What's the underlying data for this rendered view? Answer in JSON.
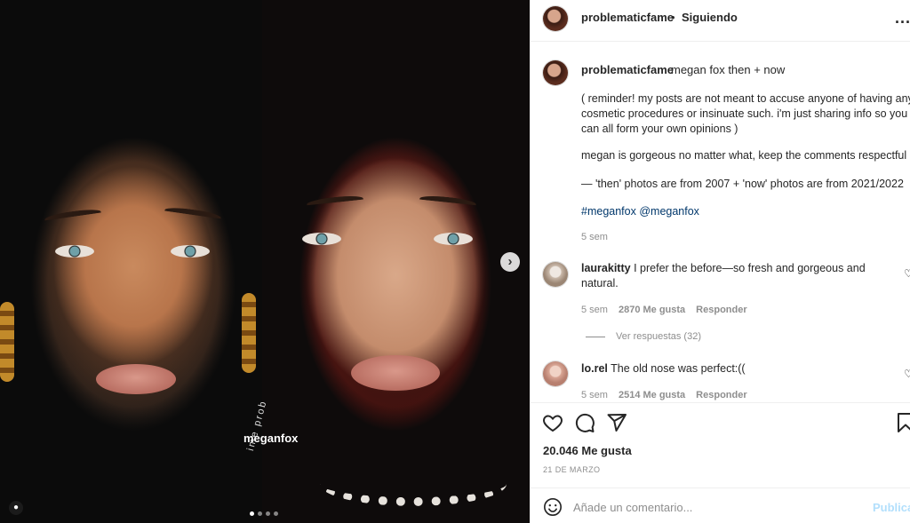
{
  "media": {
    "watermark_name": "meganfox",
    "watermark_sub": "ime prob",
    "next_glyph": "›",
    "carousel": {
      "count": 4,
      "active_index": 0
    }
  },
  "header": {
    "username": "problematicfame",
    "separator": "•",
    "follow_status": "Siguiendo",
    "more": "..."
  },
  "caption": {
    "username": "problematicfame",
    "first_line": "megan fox then + now",
    "reminder_lines": [
      "( reminder! my posts are not meant to accuse anyone of having any",
      "cosmetic procedures or insinuate such. i'm just sharing info so you",
      "can all form your own opinions )"
    ],
    "respect": "megan is gorgeous no matter what, keep the comments respectful",
    "dates": "— 'then' photos are from 2007 + 'now' photos are from 2021/2022",
    "hashtag": "#meganfox",
    "mention": "@meganfox",
    "age": "5 sem"
  },
  "comments": [
    {
      "username": "laurakitty",
      "text_line1": "I prefer the before—so fresh and gorgeous and",
      "text_line2": "natural.",
      "age": "5 sem",
      "likes": "2870 Me gusta",
      "reply": "Responder",
      "view_replies": "Ver respuestas (32)"
    },
    {
      "username": "lo.rel",
      "text_line1": "The old nose was perfect:((",
      "age": "5 sem",
      "likes": "2514 Me gusta",
      "reply": "Responder"
    }
  ],
  "stats": {
    "likes": "20.046 Me gusta",
    "date": "21 DE MARZO"
  },
  "comment_box": {
    "placeholder": "Añade un comentario...",
    "publish": "Publica"
  }
}
